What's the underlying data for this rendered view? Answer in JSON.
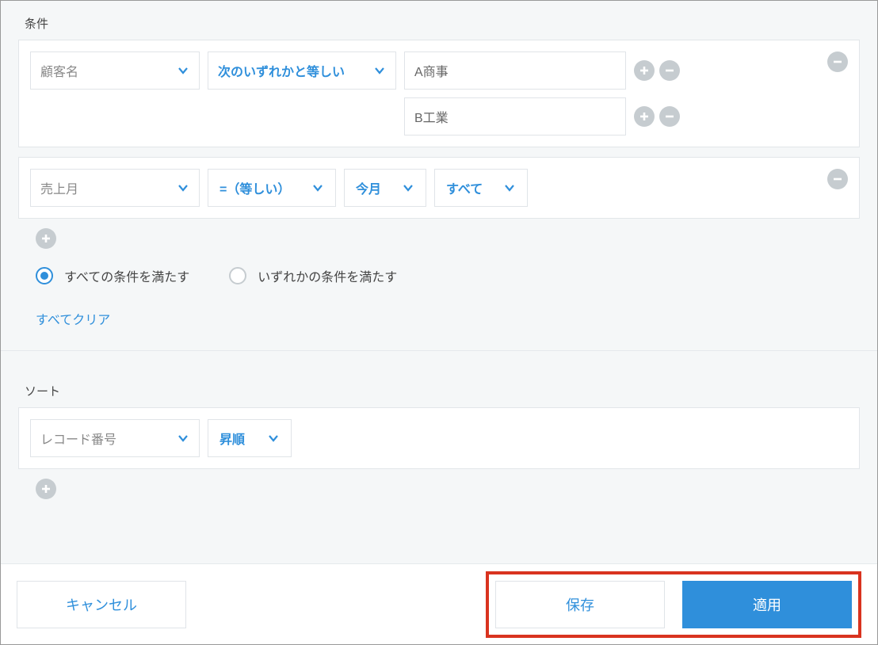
{
  "labels": {
    "conditions_title": "条件",
    "sort_title": "ソート"
  },
  "cond1": {
    "field": "顧客名",
    "operator": "次のいずれかと等しい",
    "value1": "A商事",
    "value2": "B工業"
  },
  "cond2": {
    "field": "売上月",
    "operator": "=（等しい）",
    "range": "今月",
    "scope": "すべて"
  },
  "logic": {
    "all": "すべての条件を満たす",
    "any": "いずれかの条件を満たす",
    "selected": "all"
  },
  "clear_all": "すべてクリア",
  "sort": {
    "field": "レコード番号",
    "direction": "昇順"
  },
  "footer": {
    "cancel": "キャンセル",
    "save": "保存",
    "apply": "適用"
  }
}
